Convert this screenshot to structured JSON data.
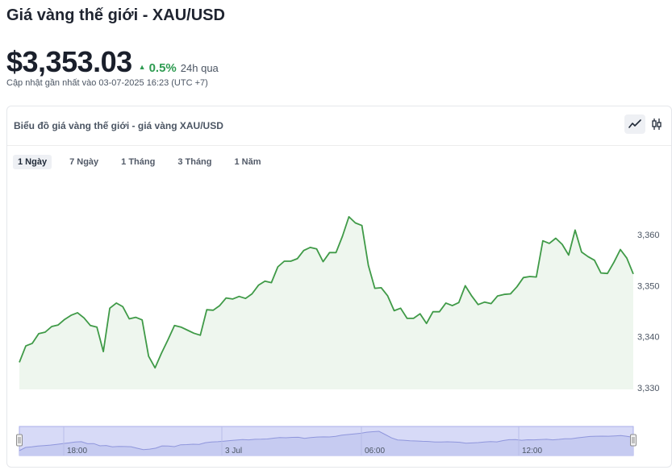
{
  "page": {
    "title": "Giá vàng thế giới - XAU/USD",
    "price": "$3,353.03",
    "change_pct": "0.5%",
    "change_period": "24h qua",
    "updated": "Cập nhật gần nhất vào 03-07-2025 16:23 (UTC +7)"
  },
  "card": {
    "title": "Biểu đồ giá vàng thế giới - giá vàng XAU/USD",
    "ranges": [
      "1 Ngày",
      "7 Ngày",
      "1 Tháng",
      "3 Tháng",
      "1 Năm"
    ],
    "active_range": "1 Ngày",
    "chart_types": [
      "line-chart-icon",
      "candlestick-icon"
    ]
  },
  "colors": {
    "up": "#2e9b51",
    "line": "#3f9a47",
    "fill": "#eef6ee",
    "navigator_fill": "#d7daf7",
    "navigator_border": "#a9aee8"
  },
  "chart_data": {
    "type": "area",
    "series": [
      {
        "values": [
          3344.8,
          3348.5,
          3349.2,
          3350.2,
          3350.7,
          3351.2,
          3352.1,
          3353.0,
          3353.8,
          3354.9,
          3355.2,
          3352.8,
          3353.0,
          3350.4,
          3350.8,
          3349.2,
          3349.7,
          3349.6,
          3349.4,
          3347.6,
          3346.0,
          3346.6,
          3347.7,
          3350.3,
          3350.2,
          3349.5,
          3351.6,
          3351.8,
          3352.3,
          3352.1,
          3354.0,
          3354.8,
          3355.2,
          3355.8,
          3356.5,
          3357.0,
          3357.6,
          3357.3,
          3358.0,
          3358.1,
          3358.3,
          3359.3,
          3360.0,
          3359.7,
          3360.2,
          3360.3,
          3359.1,
          3360.0,
          3360.6,
          3360.8,
          3360.7,
          3361.3,
          3362.7,
          3363.5,
          3364.2,
          3364.9,
          3366.2,
          3366.7,
          3367.2,
          3363.5,
          3359.6,
          3357.2,
          3356.8,
          3356.2,
          3356.0,
          3355.6,
          3355.4,
          3354.9,
          3354.8,
          3355.1,
          3354.8,
          3354.5,
          3353.5,
          3353.8,
          3354.1,
          3354.8,
          3355.3,
          3355.0,
          3356.5,
          3357.5,
          3357.6,
          3356.8,
          3357.4,
          3357.3,
          3357.7,
          3358.0,
          3357.3,
          3357.9,
          3358.6,
          3358.5,
          3359.6,
          3360.5,
          3361.2,
          3361.5,
          3361.6,
          3361.5,
          3361.9,
          3362.3,
          3361.3,
          3360.2
        ]
      }
    ],
    "y_axis": {
      "ticks": [
        3330,
        3340,
        3350,
        3360
      ],
      "tick_labels": [
        "3,330",
        "3,340",
        "3,350",
        "3,360"
      ]
    },
    "main_x_labels": [],
    "navigator": {
      "labels": [
        "18:00",
        "3 Jul",
        "06:00",
        "12:00"
      ]
    },
    "main_view": {
      "x_start": 0.0,
      "x_end": 1.0
    },
    "main_values": [
      3335.0,
      3338.2,
      3338.7,
      3340.6,
      3340.9,
      3342.0,
      3342.3,
      3343.4,
      3344.2,
      3344.7,
      3343.7,
      3342.2,
      3341.9,
      3337.1,
      3345.6,
      3346.6,
      3345.9,
      3343.5,
      3343.8,
      3343.3,
      3336.2,
      3333.9,
      3336.8,
      3339.4,
      3342.2,
      3341.9,
      3341.3,
      3340.7,
      3340.3,
      3345.3,
      3345.2,
      3346.1,
      3347.6,
      3347.4,
      3347.9,
      3347.5,
      3348.4,
      3350.1,
      3350.9,
      3350.6,
      3353.7,
      3354.8,
      3354.8,
      3355.3,
      3356.9,
      3357.5,
      3357.2,
      3354.7,
      3356.5,
      3356.5,
      3359.7,
      3363.5,
      3362.3,
      3361.8,
      3354.0,
      3349.5,
      3349.6,
      3348.0,
      3345.1,
      3345.6,
      3343.6,
      3343.6,
      3344.5,
      3342.6,
      3344.9,
      3344.9,
      3346.6,
      3346.1,
      3346.7,
      3350.0,
      3348.0,
      3346.3,
      3346.8,
      3346.5,
      3348.0,
      3348.3,
      3348.4,
      3349.8,
      3351.6,
      3351.8,
      3351.7,
      3358.8,
      3358.3,
      3359.3,
      3358.1,
      3356.0,
      3360.9,
      3356.6,
      3355.7,
      3355.0,
      3352.5,
      3352.4,
      3354.6,
      3357.1,
      3355.4,
      3352.3
    ]
  }
}
